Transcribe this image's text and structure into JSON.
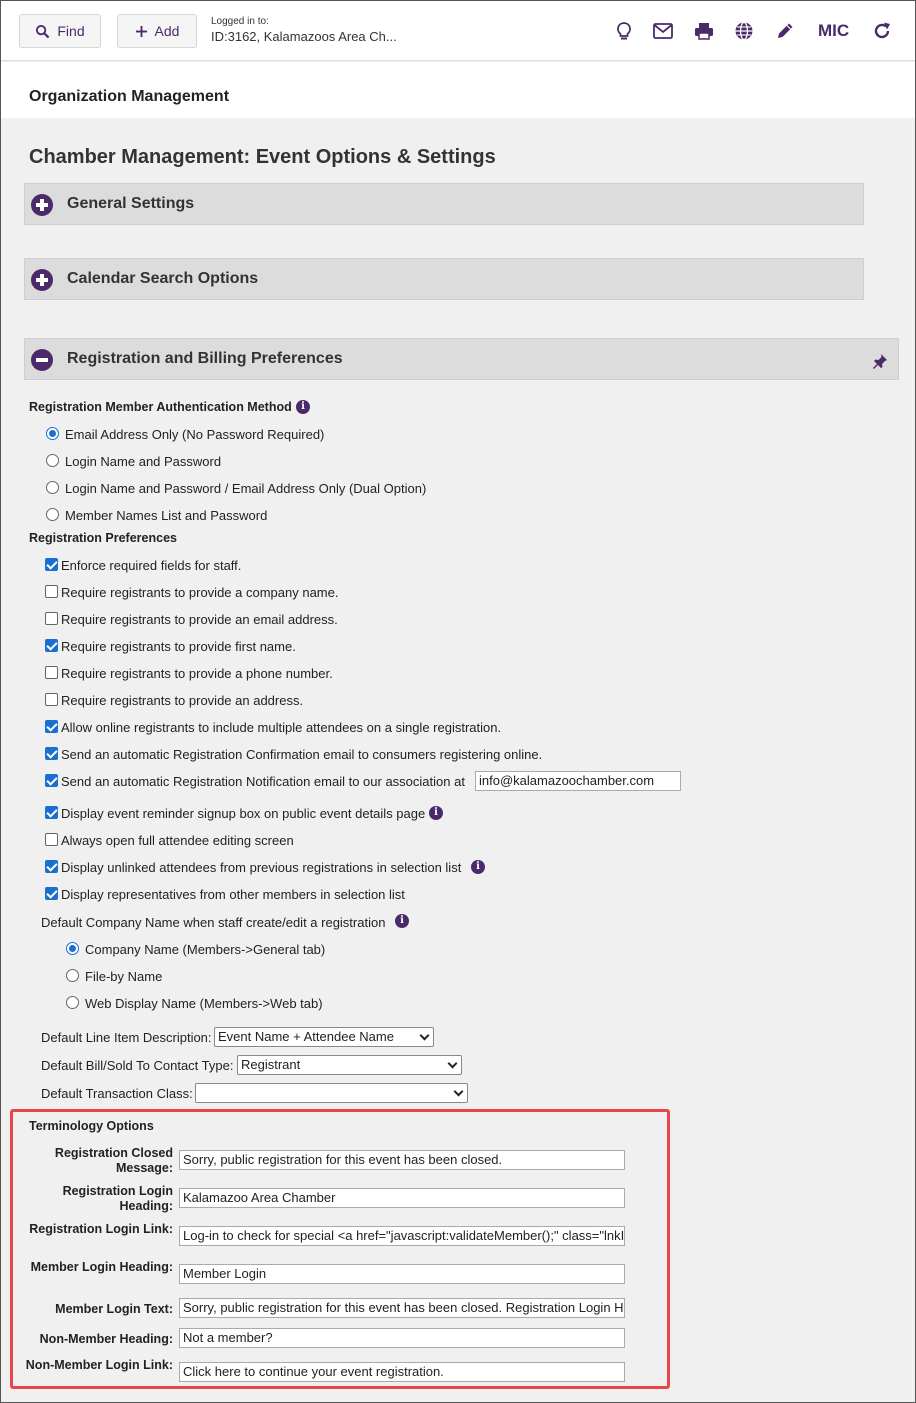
{
  "toolbar": {
    "find_label": "Find",
    "add_label": "Add",
    "logged_in_label": "Logged in to:",
    "org_id": "ID:3162, Kalamazoos Area Ch...",
    "user_initials": "MIC",
    "icons": [
      "lightbulb-icon",
      "mail-icon",
      "print-icon",
      "globe-icon",
      "pencil-icon",
      "refresh-icon"
    ]
  },
  "org_bar": {
    "title": "Organization Management"
  },
  "page": {
    "title": "Chamber Management: Event Options & Settings"
  },
  "sections": {
    "general": "General Settings",
    "calendar": "Calendar Search Options",
    "registration": "Registration and Billing Preferences"
  },
  "auth": {
    "heading": "Registration Member Authentication Method",
    "options": [
      "Email Address Only (No Password Required)",
      "Login Name and Password",
      "Login Name and Password / Email Address Only (Dual Option)",
      "Member Names List and Password"
    ],
    "selected": 0
  },
  "prefs": {
    "heading": "Registration Preferences",
    "items": [
      {
        "label": "Enforce required fields for staff.",
        "checked": true
      },
      {
        "label": "Require registrants to provide a company name.",
        "checked": false
      },
      {
        "label": "Require registrants to provide an email address.",
        "checked": false
      },
      {
        "label": "Require registrants to provide first name.",
        "checked": true
      },
      {
        "label": "Require registrants to provide a phone number.",
        "checked": false
      },
      {
        "label": "Require registrants to provide an address.",
        "checked": false
      },
      {
        "label": "Allow online registrants to include multiple attendees on a single registration.",
        "checked": true
      },
      {
        "label": "Send an automatic Registration Confirmation email to consumers registering online.",
        "checked": true
      },
      {
        "label": "Send an automatic Registration Notification email to our association at",
        "checked": true
      },
      {
        "label": "Display event reminder signup box on public event details page",
        "checked": true
      },
      {
        "label": "Always open full attendee editing screen",
        "checked": false
      },
      {
        "label": "Display unlinked attendees from previous registrations in selection list",
        "checked": true
      },
      {
        "label": "Display representatives from other members in selection list",
        "checked": true
      }
    ],
    "notification_email": "info@kalamazoochamber.com"
  },
  "company_name": {
    "heading": "Default Company Name when staff create/edit a registration",
    "options": [
      "Company Name (Members->General tab)",
      "File-by Name",
      "Web Display Name (Members->Web tab)"
    ],
    "selected": 0
  },
  "defaults": {
    "line_item_label": "Default Line Item Description:",
    "line_item_value": "Event Name + Attendee Name",
    "bill_to_label": "Default Bill/Sold To Contact Type:",
    "bill_to_value": "Registrant",
    "transaction_label": "Default Transaction Class:",
    "transaction_value": ""
  },
  "terminology": {
    "heading": "Terminology Options",
    "rows": [
      {
        "label": "Registration Closed Message:",
        "value": "Sorry, public registration for this event has been closed."
      },
      {
        "label": "Registration Login Heading:",
        "value": "Kalamazoo Area Chamber"
      },
      {
        "label": "Registration Login Link:",
        "value": "Log-in to check for special <a href=\"javascript:validateMember();\" class=\"lnkI"
      },
      {
        "label": "Member Login Heading:",
        "value": "Member Login"
      },
      {
        "label": "Member Login Text:",
        "value": "Sorry, public registration for this event has been closed. Registration Login H"
      },
      {
        "label": "Non-Member Heading:",
        "value": "Not a member?"
      },
      {
        "label": "Non-Member Login Link:",
        "value": "Click here to continue your event registration."
      }
    ]
  },
  "colors": {
    "brand": "#4a2a6a",
    "accent": "#1a6fd1",
    "highlight": "#e8464b"
  }
}
